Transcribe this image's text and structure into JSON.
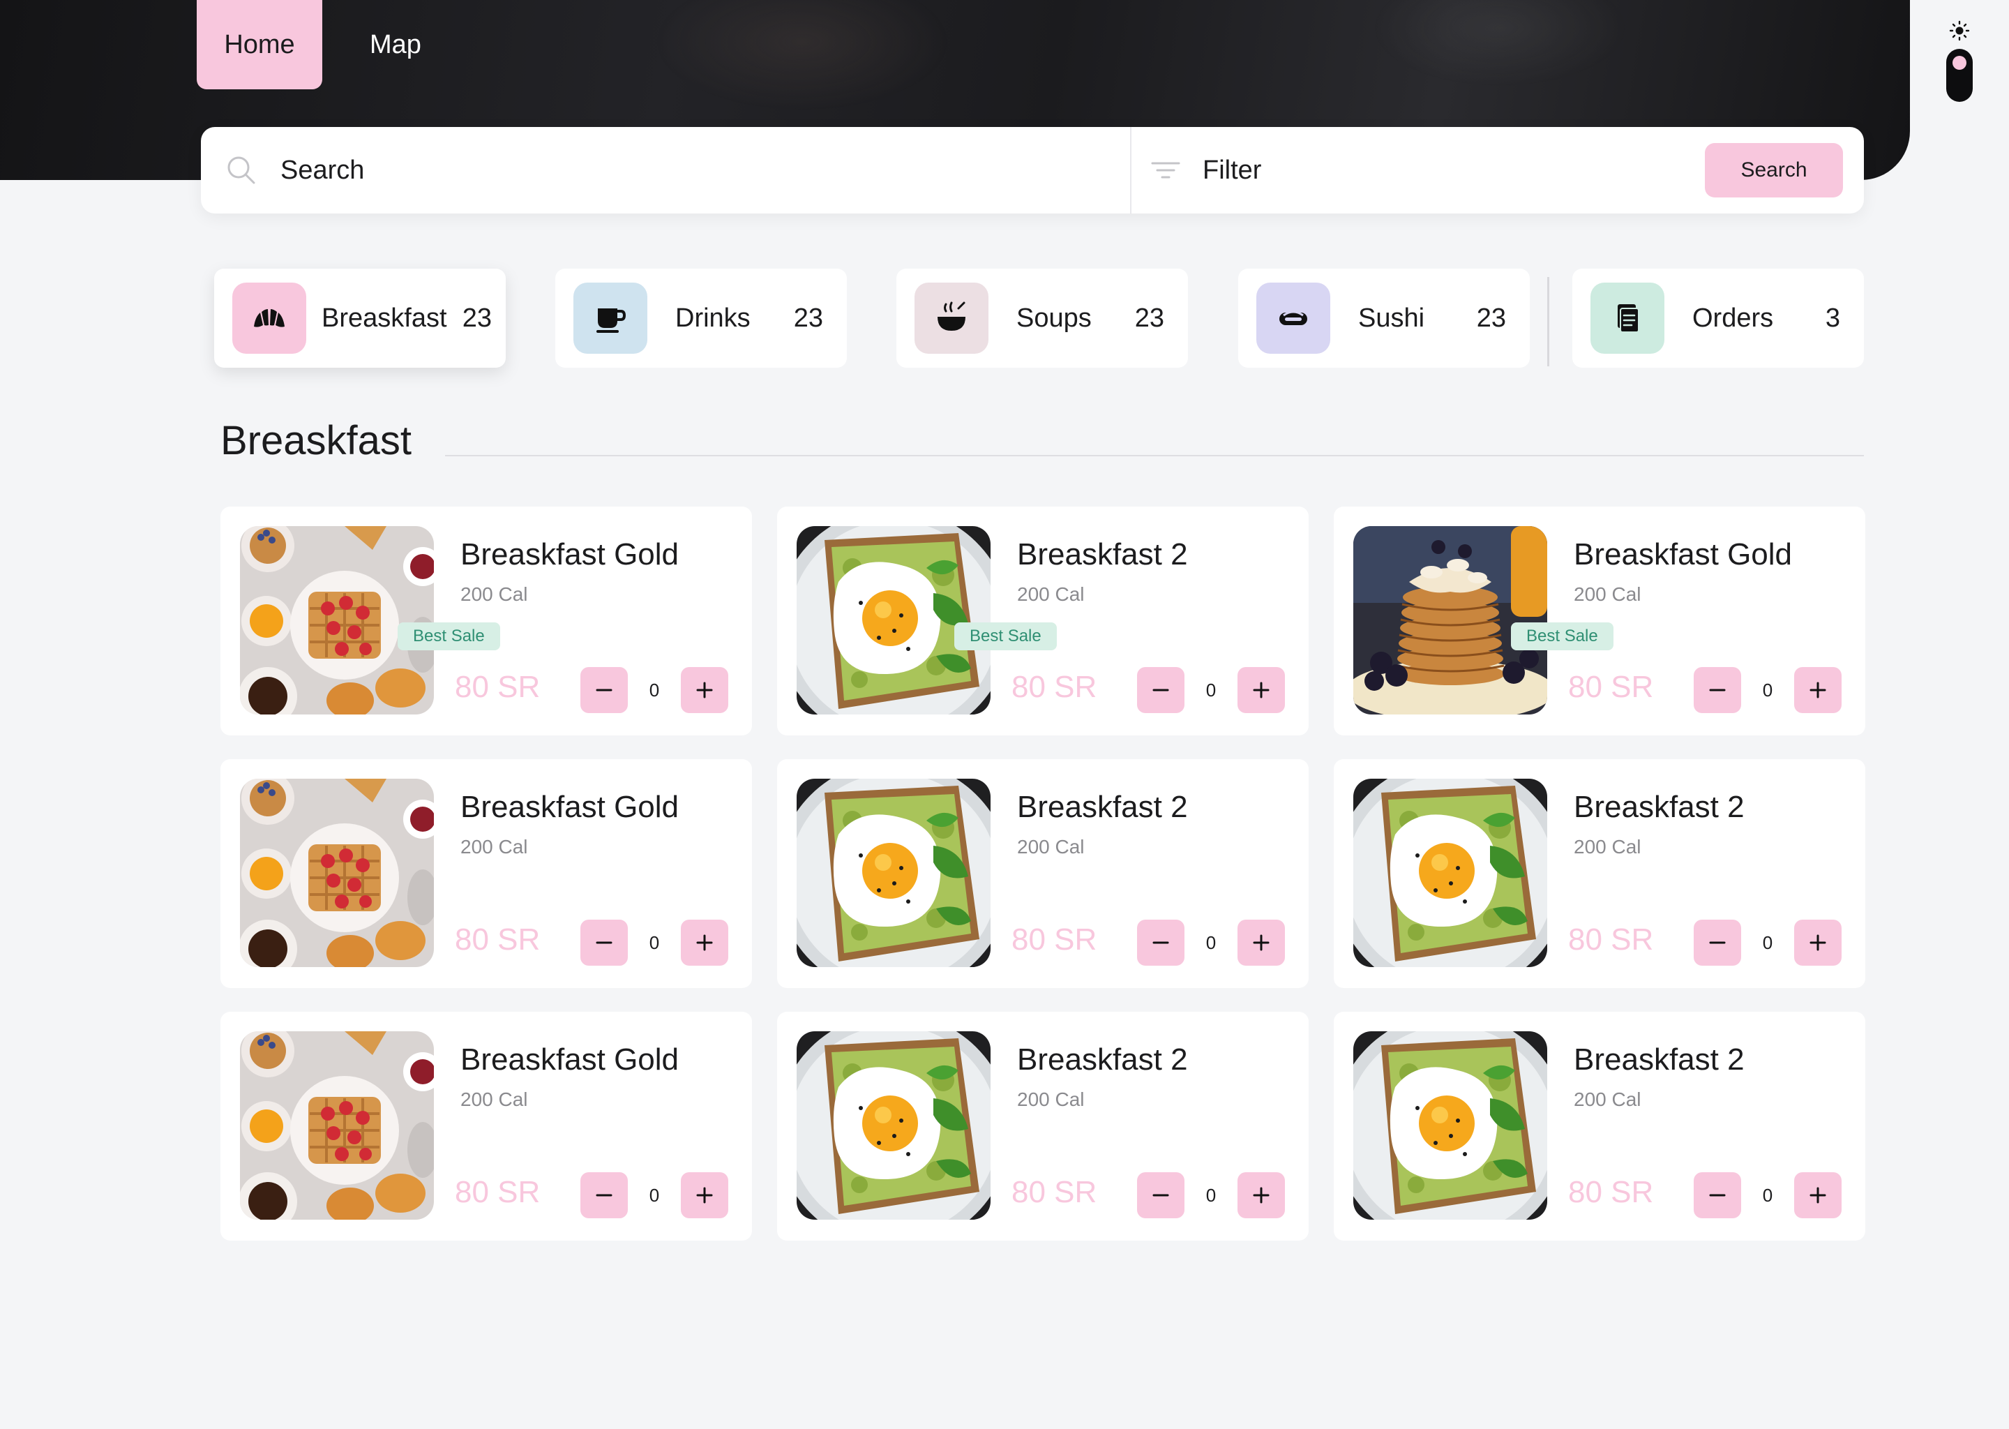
{
  "nav": {
    "tabs": [
      {
        "label": "Home",
        "active": true
      },
      {
        "label": "Map",
        "active": false
      }
    ]
  },
  "theme_toggle": {
    "mode": "light",
    "icons": [
      "sun-icon",
      "moon-icon"
    ]
  },
  "search": {
    "placeholder": "Search",
    "filter_label": "Filter",
    "button_label": "Search"
  },
  "categories": [
    {
      "label": "Breaskfast",
      "count": "23",
      "icon": "croissant-icon",
      "icon_bg": "#f8c7dd",
      "active": true
    },
    {
      "label": "Drinks",
      "count": "23",
      "icon": "coffee-cup-icon",
      "icon_bg": "#cfe3ef",
      "active": false
    },
    {
      "label": "Soups",
      "count": "23",
      "icon": "soup-bowl-icon",
      "icon_bg": "#ecdfe3",
      "active": false
    },
    {
      "label": "Sushi",
      "count": "23",
      "icon": "sushi-icon",
      "icon_bg": "#d8d6f3",
      "active": false
    },
    {
      "label": "Orders",
      "count": "3",
      "icon": "orders-document-icon",
      "icon_bg": "#cdebe0",
      "active": false
    }
  ],
  "section": {
    "title": "Breaskfast"
  },
  "products": [
    {
      "title": "Breaskfast Gold",
      "calories": "200 Cal",
      "price": "80 SR",
      "quantity": "0",
      "badge": "Best Sale",
      "image": "waffle-spread"
    },
    {
      "title": "Breaskfast 2",
      "calories": "200 Cal",
      "price": "80 SR",
      "quantity": "0",
      "badge": "Best Sale",
      "image": "egg-avocado-toast"
    },
    {
      "title": "Breaskfast Gold",
      "calories": "200 Cal",
      "price": "80 SR",
      "quantity": "0",
      "badge": "Best Sale",
      "image": "pancake-stack"
    },
    {
      "title": "Breaskfast Gold",
      "calories": "200 Cal",
      "price": "80 SR",
      "quantity": "0",
      "badge": "",
      "image": "waffle-spread"
    },
    {
      "title": "Breaskfast 2",
      "calories": "200 Cal",
      "price": "80 SR",
      "quantity": "0",
      "badge": "",
      "image": "egg-avocado-toast"
    },
    {
      "title": "Breaskfast 2",
      "calories": "200 Cal",
      "price": "80 SR",
      "quantity": "0",
      "badge": "",
      "image": "egg-avocado-toast"
    },
    {
      "title": "Breaskfast Gold",
      "calories": "200 Cal",
      "price": "80 SR",
      "quantity": "0",
      "badge": "",
      "image": "waffle-spread"
    },
    {
      "title": "Breaskfast 2",
      "calories": "200 Cal",
      "price": "80 SR",
      "quantity": "0",
      "badge": "",
      "image": "egg-avocado-toast"
    },
    {
      "title": "Breaskfast 2",
      "calories": "200 Cal",
      "price": "80 SR",
      "quantity": "0",
      "badge": "",
      "image": "egg-avocado-toast"
    }
  ],
  "colors": {
    "accent": "#f8c7dd",
    "badge_bg": "#d7efe5",
    "badge_text": "#2f8f73",
    "page_bg": "#f4f5f7",
    "header_bg": "#1b1b1e"
  }
}
